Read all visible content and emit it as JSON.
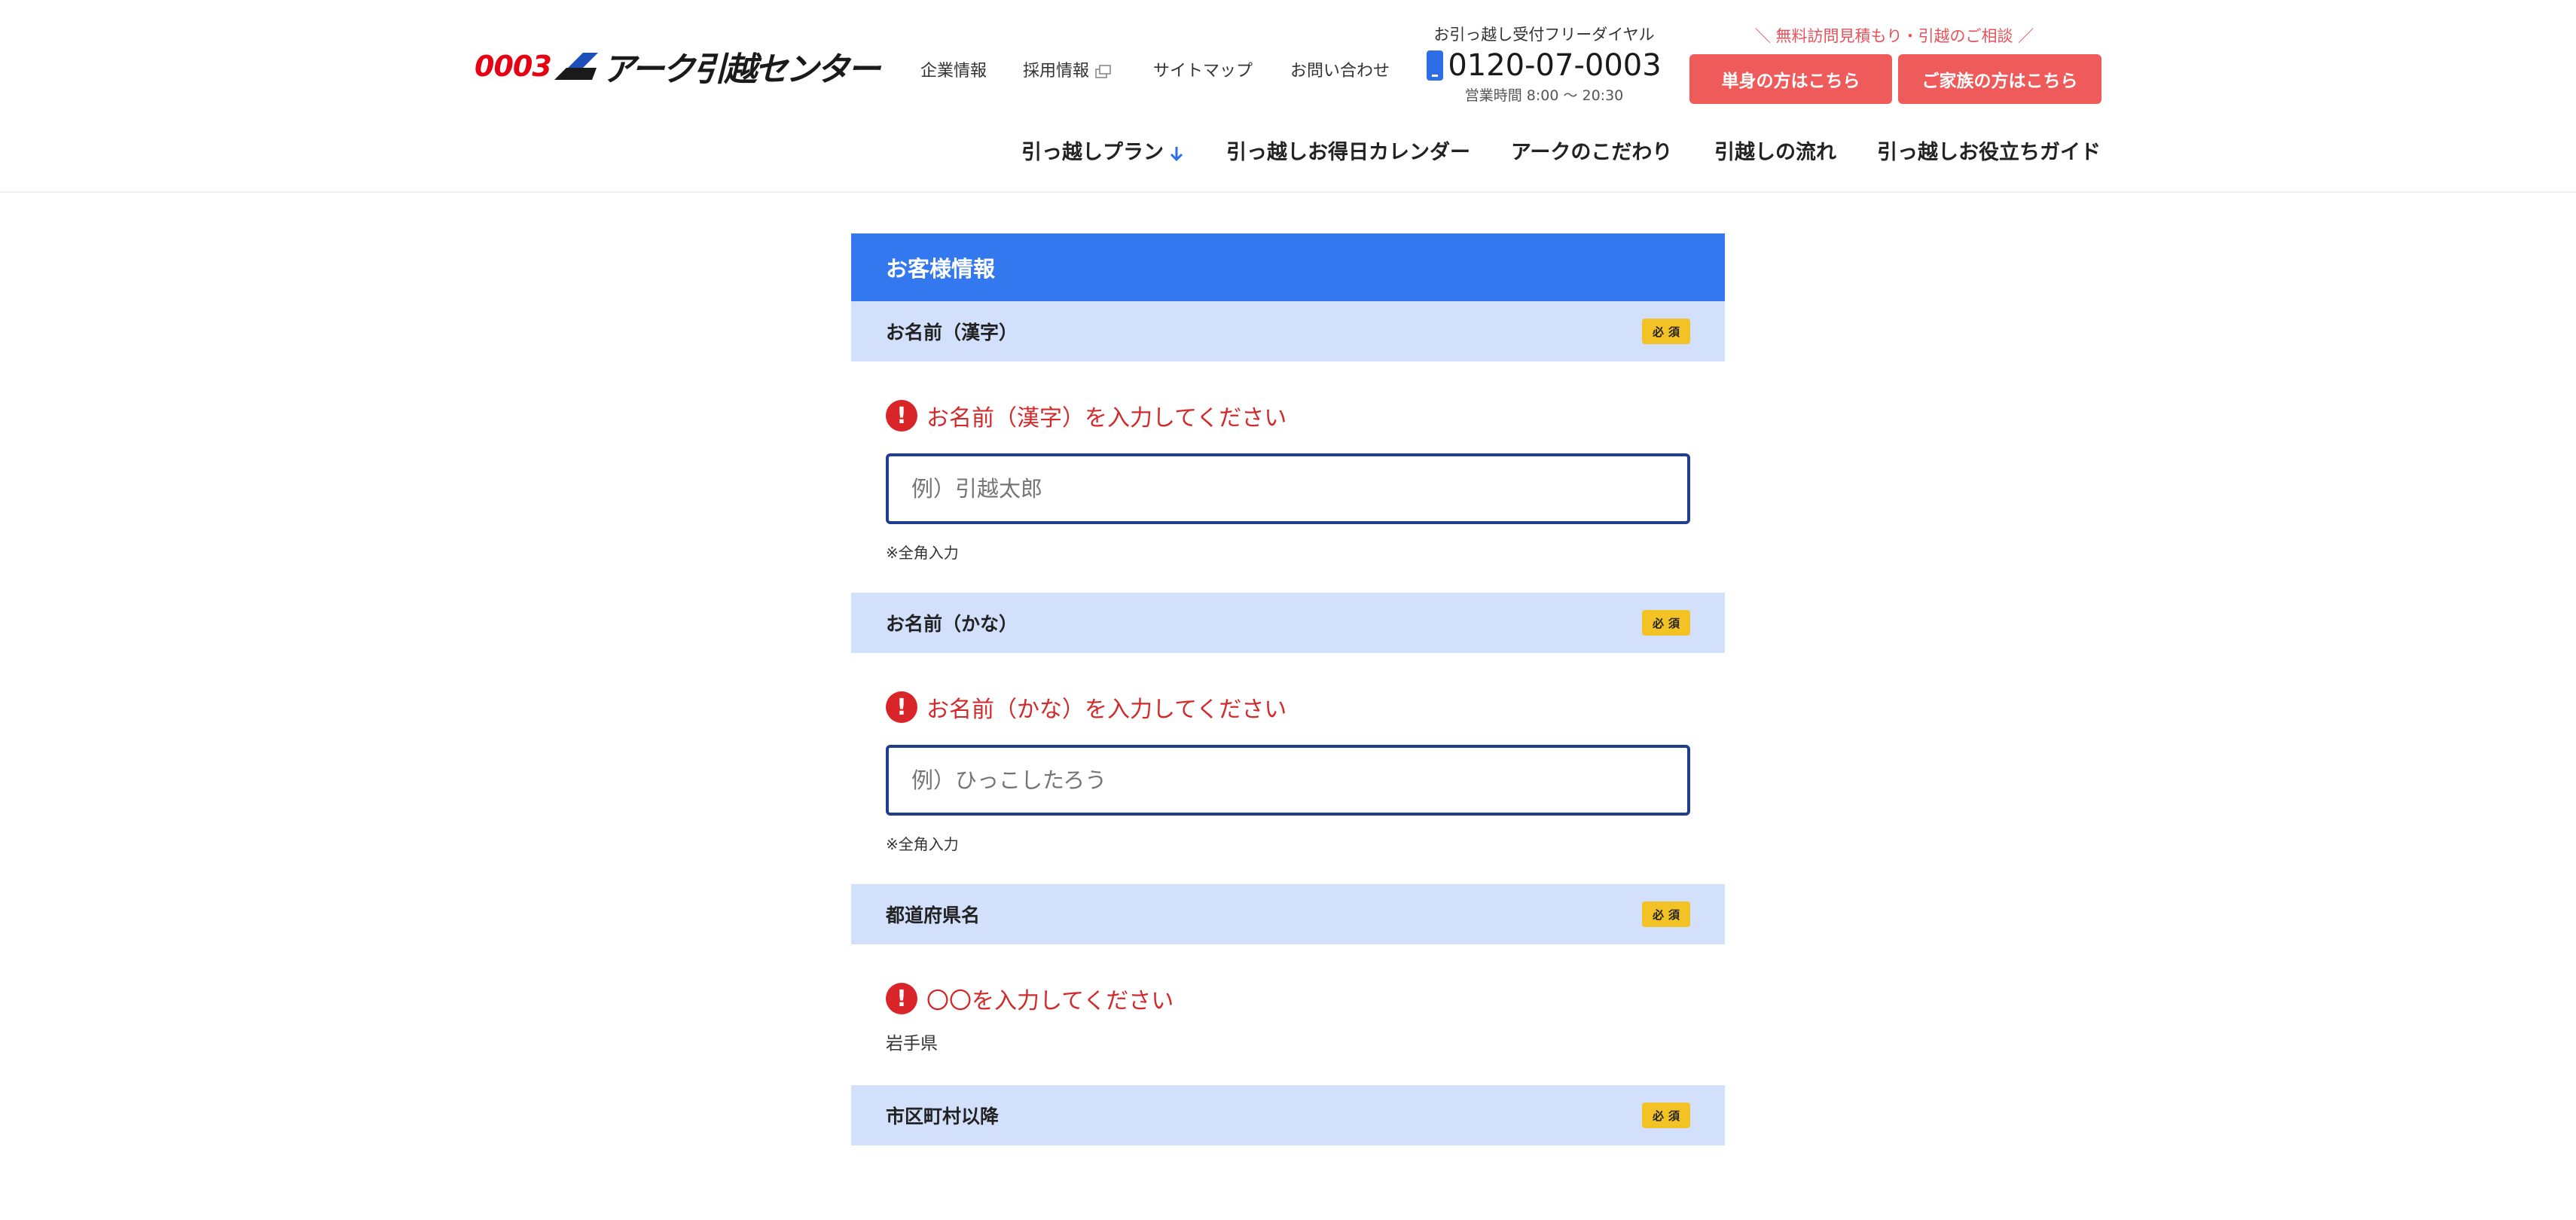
{
  "header": {
    "logo": {
      "number": "0003",
      "name": "アーク引越センター"
    },
    "topnav": [
      {
        "label": "企業情報"
      },
      {
        "label": "採用情報"
      },
      {
        "label": "サイトマップ"
      },
      {
        "label": "お問い合わせ"
      }
    ],
    "phone": {
      "label": "お引っ越し受付フリーダイヤル",
      "number": "0120-07-0003",
      "hours": "営業時間 8:00 〜 20:30"
    },
    "cta": {
      "lead": "＼ 無料訪問見積もり・引越のご相談 ／",
      "single_label": "単身の方はこちら",
      "family_label": "ご家族の方はこちら"
    },
    "mainnav": [
      {
        "label": "引っ越しプラン"
      },
      {
        "label": "引っ越しお得日カレンダー"
      },
      {
        "label": "アークのこだわり"
      },
      {
        "label": "引越しの流れ"
      },
      {
        "label": "引っ越しお役立ちガイド"
      }
    ]
  },
  "form": {
    "title": "お客様情報",
    "required_label": "必須",
    "fields": [
      {
        "label": "お名前（漢字）",
        "error": "お名前（漢字）を入力してください",
        "placeholder": "例）引越太郎",
        "value": "",
        "note": "※全角入力"
      },
      {
        "label": "お名前（かな）",
        "error": "お名前（かな）を入力してください",
        "placeholder": "例）ひっこしたろう",
        "value": "",
        "note": "※全角入力"
      },
      {
        "label": "都道府県名",
        "error": "〇〇を入力してください",
        "value": "岩手県"
      },
      {
        "label": "市区町村以降"
      }
    ]
  },
  "colors": {
    "primary_blue": "#3478f0",
    "field_header_bg": "#d2e0fb",
    "cta_red": "#ef5a5a",
    "error_red": "#d22a2a",
    "required_yellow": "#f3c325",
    "input_border": "#1f3f8c"
  }
}
